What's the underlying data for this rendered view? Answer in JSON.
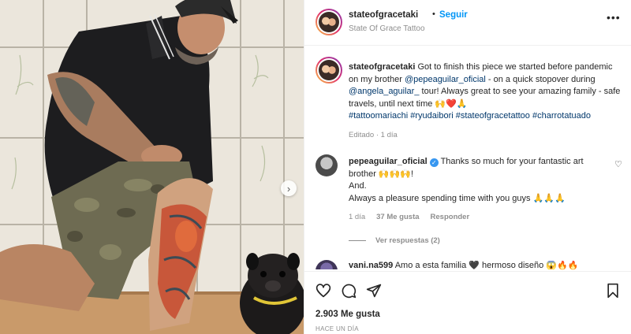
{
  "post": {
    "username": "stateofgracetaki",
    "follow_label": "Seguir",
    "location": "State Of Grace Tattoo",
    "more_icon": "more-options-icon"
  },
  "caption": {
    "username": "stateofgracetaki",
    "text_1": "Got to finish this piece we started before pandemic on my brother",
    "mention_1": "@pepeaguilar_oficial",
    "text_2": "- on a quick stopover during",
    "mention_2": "@angela_aguilar_",
    "text_3": "tour! Always great to see your amazing family - safe travels, until next time 🙌❤️🙏",
    "hashtags": "#tattoomariachi #ryudaibori #stateofgracetattoo #charrotatuado",
    "meta": "Editado · 1 día"
  },
  "comment": {
    "username": "pepeaguilar_oficial",
    "text_1": "Thanks so much for your fantastic art brother 🙌🙌🙌!",
    "text_2": "And.",
    "text_3": "Always a pleasure spending time with you guys 🙏🙏🙏",
    "age": "1 día",
    "likes": "37 Me gusta",
    "reply_label": "Responder",
    "view_replies": "Ver respuestas (2)"
  },
  "comment2": {
    "username": "vani.na599",
    "text": "Amo a esta familia 🖤 hermoso diseño 😱🔥🔥"
  },
  "footer": {
    "likes_total": "2.903 Me gusta",
    "time_ago": "HACE UN DÍA"
  },
  "colors": {
    "link_blue": "#0095f6",
    "mention": "#00376b",
    "muted": "#8e8e8e"
  }
}
